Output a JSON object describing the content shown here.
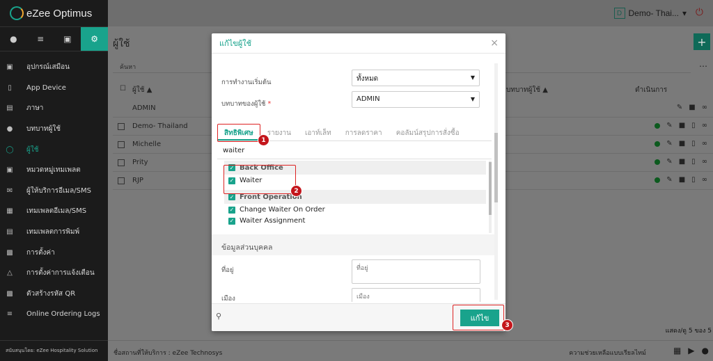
{
  "app": {
    "name": "eZee Optimus"
  },
  "sidebar": {
    "tabs": [
      "person-icon",
      "list-icon",
      "cart-icon",
      "gear-icon"
    ],
    "items": [
      {
        "label": "อุปกรณ์เสมือน",
        "icon": "device-icon"
      },
      {
        "label": "App Device",
        "icon": "tablet-icon"
      },
      {
        "label": "ภาษา",
        "icon": "language-icon"
      },
      {
        "label": "บทบาทผู้ใช้",
        "icon": "user-role-icon"
      },
      {
        "label": "ผู้ใช้",
        "icon": "user-icon",
        "active": true
      },
      {
        "label": "หมวดหมู่เทมเพลต",
        "icon": "inbox-icon"
      },
      {
        "label": "ผู้ให้บริการอีเมล/SMS",
        "icon": "mail-icon"
      },
      {
        "label": "เทมเพลตอีเมล/SMS",
        "icon": "calendar-icon"
      },
      {
        "label": "เทมเพลตการพิมพ์",
        "icon": "print-template-icon"
      },
      {
        "label": "การตั้งค่า",
        "icon": "settings-icon"
      },
      {
        "label": "การตั้งค่าการแจ้งเตือน",
        "icon": "bell-icon"
      },
      {
        "label": "ตัวสร้างรหัส QR",
        "icon": "qr-icon"
      },
      {
        "label": "Online Ordering Logs",
        "icon": "list-icon"
      }
    ],
    "footer": "สนับสนุนโดย: eZee Hospitality Solution"
  },
  "topbar": {
    "property_initial": "D",
    "property_name": "Demo- Thai...",
    "power_icon": "power-icon"
  },
  "main": {
    "title": "ผู้ใช้",
    "search_placeholder": "ค้นหา",
    "columns": {
      "user": "ผู้ใช้ ▲",
      "role": "บทบาทผู้ใช้ ▲",
      "actions": "ดำเนินการ"
    },
    "rows": [
      {
        "name": "ADMIN",
        "active": false
      },
      {
        "name": "Demo- Thailand",
        "active": true
      },
      {
        "name": "Michelle",
        "active": true
      },
      {
        "name": "Prity",
        "active": true
      },
      {
        "name": "RJP",
        "active": true
      }
    ],
    "paging": "แสดง/ดู 5 ของ 5"
  },
  "bottom": {
    "left": "ชื่อสถานที่ให้บริการ : eZee Technosys",
    "right": "ความช่วยเหลือแบบเรียลไทม์"
  },
  "modal": {
    "title": "แก้ไขผู้ใช้",
    "close": "×",
    "fields": {
      "start_label": "การทำงานเริ่มต้น",
      "start_value": "ทั้งหมด",
      "role_label": "บทบาทของผู้ใช้",
      "role_required": "*",
      "role_value": "ADMIN"
    },
    "tabs": [
      "สิทธิพิเศษ",
      "รายงาน",
      "เอาท์เล็ท",
      "การลดราคา",
      "คอลัมน์สรุปการสั่งซื้อ"
    ],
    "filter_value": "waiter",
    "groups": [
      {
        "label": "Back Office",
        "items": [
          "Waiter"
        ]
      },
      {
        "label": "Front Operation",
        "items": [
          "Change Waiter On Order",
          "Waiter Assignment"
        ]
      }
    ],
    "section_title": "ข้อมูลส่วนบุคคล",
    "address_label": "ที่อยู่",
    "address_placeholder": "ที่อยู่",
    "city_label": "เมือง",
    "city_placeholder": "เมือง",
    "save_label": "แก้ไข"
  },
  "annotations": [
    "1",
    "2",
    "3"
  ],
  "colors": {
    "accent": "#19a38c",
    "annotation": "#c4161c"
  }
}
